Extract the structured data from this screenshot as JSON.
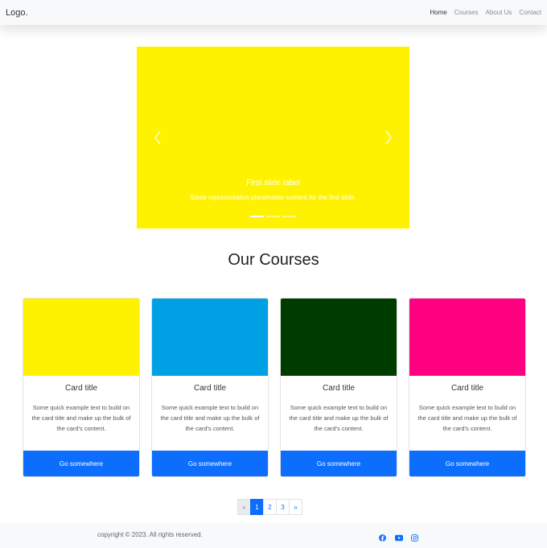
{
  "navbar": {
    "brand": "Logo.",
    "links": [
      "Home",
      "Courses",
      "About Us",
      "Contact"
    ]
  },
  "carousel": {
    "slide_color": "#fff200",
    "prev_icon": "chevron-left-icon",
    "next_icon": "chevron-right-icon",
    "caption_title": "First slide label",
    "caption_text": "Some representative placeholder content for the first slide.",
    "indicator_count": 3,
    "active_indicator": 0
  },
  "section": {
    "title": "Our Courses"
  },
  "cards": [
    {
      "color": "#fff200",
      "title": "Card title",
      "text": "Some quick example text to build on the card title and make up the bulk of the card's content.",
      "button": "Go somewhere"
    },
    {
      "color": "#00a0e4",
      "title": "Card title",
      "text": "Some quick example text to build on the card title and make up the bulk of the card's content.",
      "button": "Go somewhere"
    },
    {
      "color": "#003b00",
      "title": "Card title",
      "text": "Some quick example text to build on the card title and make up the bulk of the card's content.",
      "button": "Go somewhere"
    },
    {
      "color": "#ff0080",
      "title": "Card title",
      "text": "Some quick example text to build on the card title and make up the bulk of the card's content.",
      "button": "Go somewhere"
    }
  ],
  "pagination": {
    "prev": "«",
    "pages": [
      "1",
      "2",
      "3"
    ],
    "active": "1",
    "next": "»"
  },
  "footer": {
    "copyright": "copyright © 2023. All rights reserved.",
    "social_icons": [
      "facebook-icon",
      "youtube-icon",
      "instagram-icon"
    ]
  },
  "colors": {
    "primary": "#0d6efd",
    "facebook": "#1877f2",
    "youtube": "#0d6efd",
    "instagram": "#0d6efd"
  }
}
